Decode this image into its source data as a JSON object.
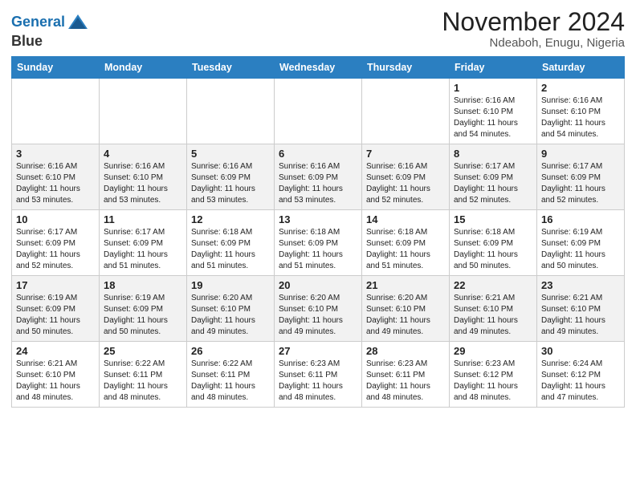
{
  "header": {
    "logo_line1": "General",
    "logo_line2": "Blue",
    "month_title": "November 2024",
    "location": "Ndeaboh, Enugu, Nigeria"
  },
  "weekdays": [
    "Sunday",
    "Monday",
    "Tuesday",
    "Wednesday",
    "Thursday",
    "Friday",
    "Saturday"
  ],
  "weeks": [
    [
      {
        "day": "",
        "info": ""
      },
      {
        "day": "",
        "info": ""
      },
      {
        "day": "",
        "info": ""
      },
      {
        "day": "",
        "info": ""
      },
      {
        "day": "",
        "info": ""
      },
      {
        "day": "1",
        "info": "Sunrise: 6:16 AM\nSunset: 6:10 PM\nDaylight: 11 hours and 54 minutes."
      },
      {
        "day": "2",
        "info": "Sunrise: 6:16 AM\nSunset: 6:10 PM\nDaylight: 11 hours and 54 minutes."
      }
    ],
    [
      {
        "day": "3",
        "info": "Sunrise: 6:16 AM\nSunset: 6:10 PM\nDaylight: 11 hours and 53 minutes."
      },
      {
        "day": "4",
        "info": "Sunrise: 6:16 AM\nSunset: 6:10 PM\nDaylight: 11 hours and 53 minutes."
      },
      {
        "day": "5",
        "info": "Sunrise: 6:16 AM\nSunset: 6:09 PM\nDaylight: 11 hours and 53 minutes."
      },
      {
        "day": "6",
        "info": "Sunrise: 6:16 AM\nSunset: 6:09 PM\nDaylight: 11 hours and 53 minutes."
      },
      {
        "day": "7",
        "info": "Sunrise: 6:16 AM\nSunset: 6:09 PM\nDaylight: 11 hours and 52 minutes."
      },
      {
        "day": "8",
        "info": "Sunrise: 6:17 AM\nSunset: 6:09 PM\nDaylight: 11 hours and 52 minutes."
      },
      {
        "day": "9",
        "info": "Sunrise: 6:17 AM\nSunset: 6:09 PM\nDaylight: 11 hours and 52 minutes."
      }
    ],
    [
      {
        "day": "10",
        "info": "Sunrise: 6:17 AM\nSunset: 6:09 PM\nDaylight: 11 hours and 52 minutes."
      },
      {
        "day": "11",
        "info": "Sunrise: 6:17 AM\nSunset: 6:09 PM\nDaylight: 11 hours and 51 minutes."
      },
      {
        "day": "12",
        "info": "Sunrise: 6:18 AM\nSunset: 6:09 PM\nDaylight: 11 hours and 51 minutes."
      },
      {
        "day": "13",
        "info": "Sunrise: 6:18 AM\nSunset: 6:09 PM\nDaylight: 11 hours and 51 minutes."
      },
      {
        "day": "14",
        "info": "Sunrise: 6:18 AM\nSunset: 6:09 PM\nDaylight: 11 hours and 51 minutes."
      },
      {
        "day": "15",
        "info": "Sunrise: 6:18 AM\nSunset: 6:09 PM\nDaylight: 11 hours and 50 minutes."
      },
      {
        "day": "16",
        "info": "Sunrise: 6:19 AM\nSunset: 6:09 PM\nDaylight: 11 hours and 50 minutes."
      }
    ],
    [
      {
        "day": "17",
        "info": "Sunrise: 6:19 AM\nSunset: 6:09 PM\nDaylight: 11 hours and 50 minutes."
      },
      {
        "day": "18",
        "info": "Sunrise: 6:19 AM\nSunset: 6:09 PM\nDaylight: 11 hours and 50 minutes."
      },
      {
        "day": "19",
        "info": "Sunrise: 6:20 AM\nSunset: 6:10 PM\nDaylight: 11 hours and 49 minutes."
      },
      {
        "day": "20",
        "info": "Sunrise: 6:20 AM\nSunset: 6:10 PM\nDaylight: 11 hours and 49 minutes."
      },
      {
        "day": "21",
        "info": "Sunrise: 6:20 AM\nSunset: 6:10 PM\nDaylight: 11 hours and 49 minutes."
      },
      {
        "day": "22",
        "info": "Sunrise: 6:21 AM\nSunset: 6:10 PM\nDaylight: 11 hours and 49 minutes."
      },
      {
        "day": "23",
        "info": "Sunrise: 6:21 AM\nSunset: 6:10 PM\nDaylight: 11 hours and 49 minutes."
      }
    ],
    [
      {
        "day": "24",
        "info": "Sunrise: 6:21 AM\nSunset: 6:10 PM\nDaylight: 11 hours and 48 minutes."
      },
      {
        "day": "25",
        "info": "Sunrise: 6:22 AM\nSunset: 6:11 PM\nDaylight: 11 hours and 48 minutes."
      },
      {
        "day": "26",
        "info": "Sunrise: 6:22 AM\nSunset: 6:11 PM\nDaylight: 11 hours and 48 minutes."
      },
      {
        "day": "27",
        "info": "Sunrise: 6:23 AM\nSunset: 6:11 PM\nDaylight: 11 hours and 48 minutes."
      },
      {
        "day": "28",
        "info": "Sunrise: 6:23 AM\nSunset: 6:11 PM\nDaylight: 11 hours and 48 minutes."
      },
      {
        "day": "29",
        "info": "Sunrise: 6:23 AM\nSunset: 6:12 PM\nDaylight: 11 hours and 48 minutes."
      },
      {
        "day": "30",
        "info": "Sunrise: 6:24 AM\nSunset: 6:12 PM\nDaylight: 11 hours and 47 minutes."
      }
    ]
  ]
}
